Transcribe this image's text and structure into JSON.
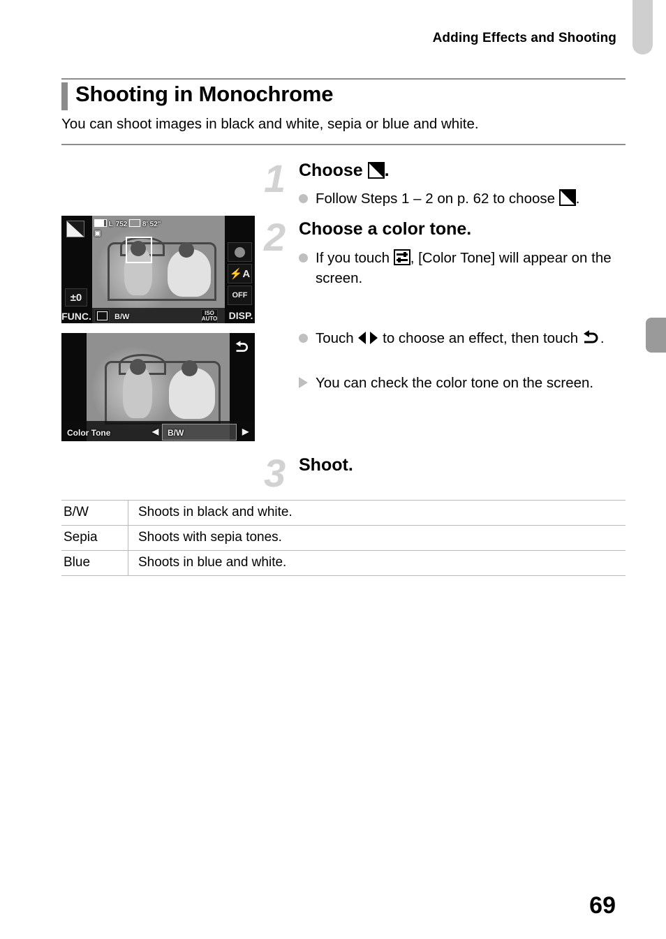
{
  "header": {
    "running_title": "Adding Effects and Shooting"
  },
  "section": {
    "title": "Shooting in Monochrome",
    "description": "You can shoot images in black and white, sepia or blue and white."
  },
  "steps": [
    {
      "number": "1",
      "heading_prefix": "Choose",
      "heading_suffix": ".",
      "heading_icon": "monochrome-mode-icon",
      "bullets": [
        {
          "marker": "dot",
          "text_before": "Follow Steps 1 – 2 on p. 62 to choose",
          "icon": "monochrome-mode-icon",
          "text_after": "."
        }
      ]
    },
    {
      "number": "2",
      "heading_prefix": "Choose a color tone.",
      "heading_suffix": "",
      "heading_icon": "",
      "bullets": [
        {
          "marker": "dot",
          "text_before": "If you touch",
          "icon": "slider-settings-icon",
          "text_after": ", [Color Tone] will appear on the screen."
        },
        {
          "marker": "dot",
          "text_before": "Touch",
          "icon": "left-right-arrows-icon",
          "text_mid": "to choose an effect, then touch",
          "icon2": "return-arrow-icon",
          "text_after": "."
        },
        {
          "marker": "triangle",
          "text_before": "You can check the color tone on the screen.",
          "icon": "",
          "text_after": ""
        }
      ]
    },
    {
      "number": "3",
      "heading_prefix": "Shoot.",
      "heading_suffix": "",
      "heading_icon": "",
      "bullets": []
    }
  ],
  "screen_shot_1": {
    "mode_icon": "monochrome-mode-icon",
    "battery": "battery-icon",
    "quality": "L",
    "shots_remaining": "752",
    "movie_icon": "movie-quality-icon",
    "movie_time": "8' 52\"",
    "macro_icon": "macro-icon",
    "exposure": "±0",
    "func_label": "FUNC.",
    "slider_icon": "slider-settings-icon",
    "color_tone_value": "B/W",
    "iso_label": "ISO",
    "iso_value": "AUTO",
    "disp_label": "DISP.",
    "record_icon": "movie-record-icon",
    "flash_label": "flash-auto-icon",
    "flash_off_label": "OFF",
    "flash_off_icon": "flash-off-icon"
  },
  "screen_shot_2": {
    "return_icon": "return-arrow-icon",
    "setting_label": "Color Tone",
    "left_arrow": "left-arrow-icon",
    "selected_value": "B/W",
    "right_arrow": "right-arrow-icon"
  },
  "table": {
    "rows": [
      {
        "key": "B/W",
        "value": "Shoots in black and white."
      },
      {
        "key": "Sepia",
        "value": "Shoots with sepia tones."
      },
      {
        "key": "Blue",
        "value": "Shoots in blue and white."
      }
    ]
  },
  "page_number": "69",
  "colors": {
    "rule": "#8c8c8c",
    "step_number": "#d2d2d2",
    "bullet": "#bfbfbf",
    "tab_light": "#cfcfcf",
    "tab_dark": "#9a9a9a"
  }
}
